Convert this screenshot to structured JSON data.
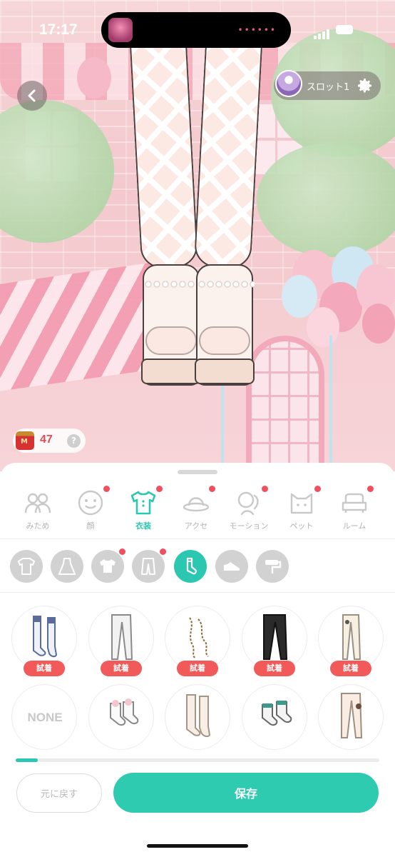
{
  "status_bar": {
    "time": "17:17"
  },
  "overlay": {
    "slot_label": "スロット1",
    "currency_value": "47",
    "help_label": "?"
  },
  "categories": [
    {
      "label": "みため",
      "active": false,
      "badge": false,
      "icon": "couple-icon"
    },
    {
      "label": "顔",
      "active": false,
      "badge": true,
      "icon": "face-icon"
    },
    {
      "label": "衣装",
      "active": true,
      "badge": true,
      "icon": "shirt-icon"
    },
    {
      "label": "アクセ",
      "active": false,
      "badge": true,
      "icon": "hat-icon"
    },
    {
      "label": "モーション",
      "active": false,
      "badge": true,
      "icon": "waving-hand-icon"
    },
    {
      "label": "ペット",
      "active": false,
      "badge": true,
      "icon": "cat-icon"
    },
    {
      "label": "ルーム",
      "active": false,
      "badge": true,
      "icon": "sofa-icon"
    }
  ],
  "subcategories": [
    {
      "icon": "outfit-icon",
      "active": false,
      "badge": false
    },
    {
      "icon": "dress-icon",
      "active": false,
      "badge": false
    },
    {
      "icon": "top-icon",
      "active": false,
      "badge": true
    },
    {
      "icon": "pants-icon",
      "active": false,
      "badge": true
    },
    {
      "icon": "socks-icon",
      "active": true,
      "badge": false
    },
    {
      "icon": "shoes-icon",
      "active": false,
      "badge": false
    },
    {
      "icon": "roller-icon",
      "active": false,
      "badge": false
    }
  ],
  "items_row1": [
    {
      "name": "blue-thigh-socks",
      "tryon_label": "試着"
    },
    {
      "name": "white-tights",
      "tryon_label": "試着"
    },
    {
      "name": "chain-legwear",
      "tryon_label": "試着"
    },
    {
      "name": "black-tights",
      "tryon_label": "試着"
    },
    {
      "name": "cream-tights",
      "tryon_label": "試着"
    }
  ],
  "items_row2": [
    {
      "name": "none",
      "label": "NONE"
    },
    {
      "name": "frilly-ankle-socks"
    },
    {
      "name": "cream-knee-socks"
    },
    {
      "name": "teal-ankle-socks"
    },
    {
      "name": "sheer-tights"
    }
  ],
  "progress": 0.06,
  "buttons": {
    "reset_label": "元に戻す",
    "save_label": "保存"
  },
  "colors": {
    "accent": "#2cc7b0",
    "badge": "#f0505e",
    "tryon": "#f25a5a"
  }
}
